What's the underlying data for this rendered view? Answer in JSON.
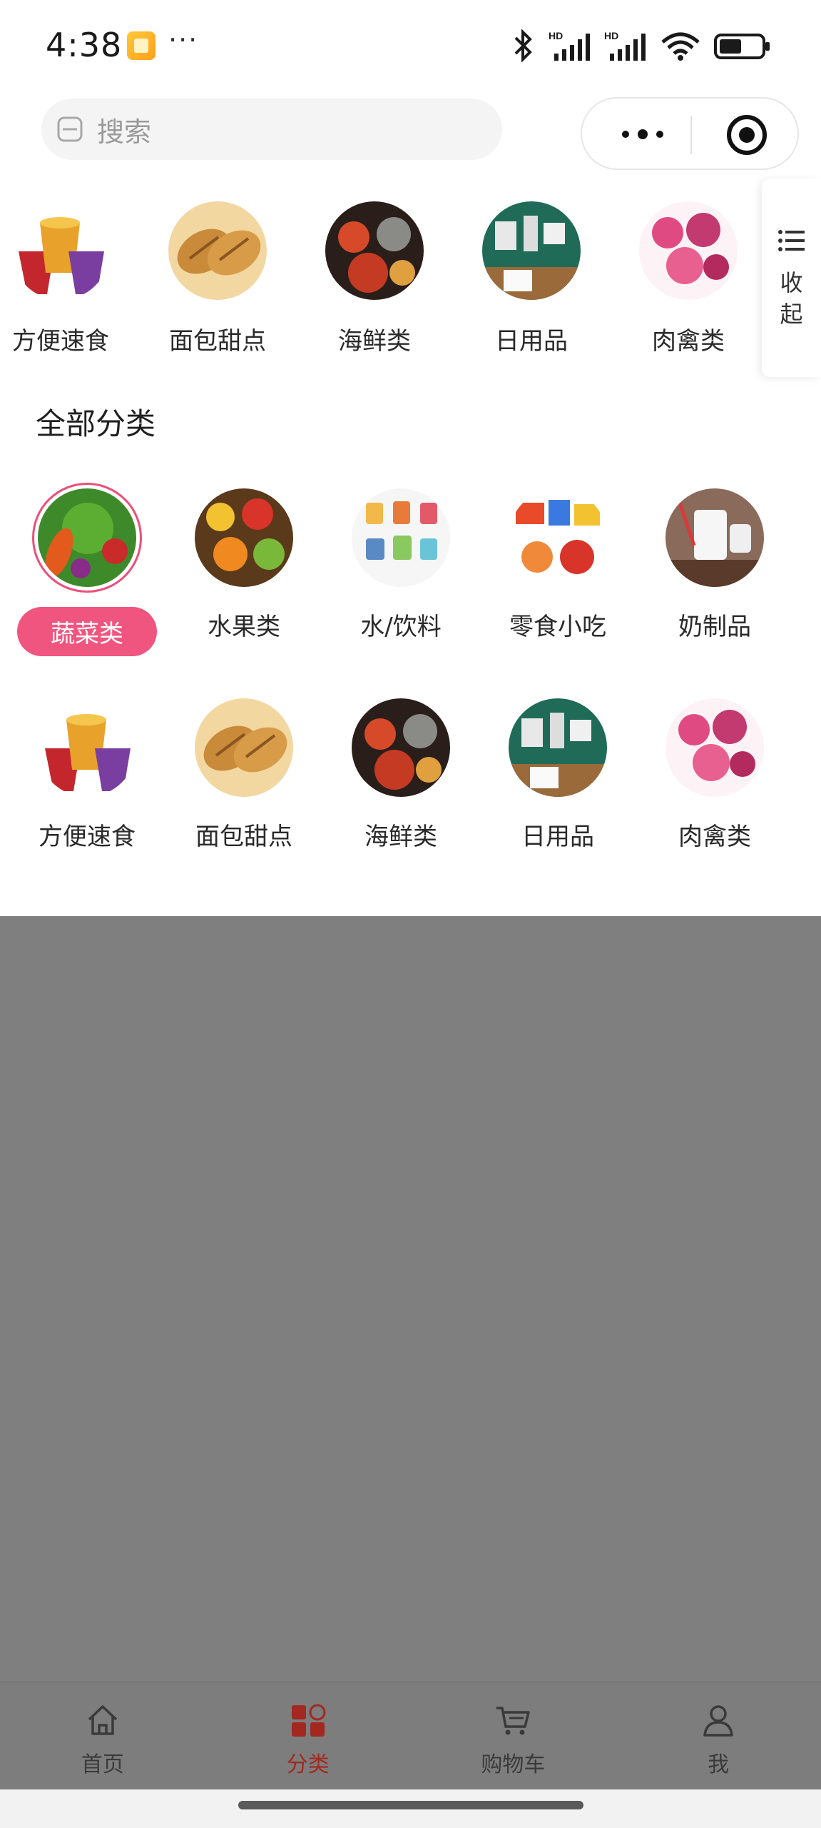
{
  "status_bar": {
    "time": "4:38",
    "dots": "···",
    "icons": [
      "bluetooth-icon",
      "signal-hd-icon",
      "signal-hd-icon",
      "wifi-icon",
      "battery-icon"
    ]
  },
  "header": {
    "search_placeholder": "搜索"
  },
  "top_categories": [
    {
      "label": "方便速食",
      "icon": "instant-food"
    },
    {
      "label": "面包甜点",
      "icon": "bread"
    },
    {
      "label": "海鲜类",
      "icon": "seafood"
    },
    {
      "label": "日用品",
      "icon": "daily-goods"
    },
    {
      "label": "肉禽类",
      "icon": "meat"
    }
  ],
  "collapse": {
    "label": "收起"
  },
  "section": {
    "title": "全部分类"
  },
  "all_categories": [
    {
      "label": "蔬菜类",
      "icon": "vegetables",
      "selected": true
    },
    {
      "label": "水果类",
      "icon": "fruits"
    },
    {
      "label": "水/饮料",
      "icon": "drinks"
    },
    {
      "label": "零食小吃",
      "icon": "snacks"
    },
    {
      "label": "奶制品",
      "icon": "dairy"
    },
    {
      "label": "方便速食",
      "icon": "instant-food"
    },
    {
      "label": "面包甜点",
      "icon": "bread"
    },
    {
      "label": "海鲜类",
      "icon": "seafood"
    },
    {
      "label": "日用品",
      "icon": "daily-goods"
    },
    {
      "label": "肉禽类",
      "icon": "meat"
    }
  ],
  "tabbar": {
    "items": [
      {
        "label": "首页",
        "icon": "home-icon"
      },
      {
        "label": "分类",
        "icon": "category-icon",
        "active": true
      },
      {
        "label": "购物车",
        "icon": "cart-icon"
      },
      {
        "label": "我",
        "icon": "user-icon"
      }
    ]
  },
  "colors": {
    "accent": "#f0557f",
    "tab_active": "#a3281f",
    "overlay": "#7f7f7f"
  }
}
